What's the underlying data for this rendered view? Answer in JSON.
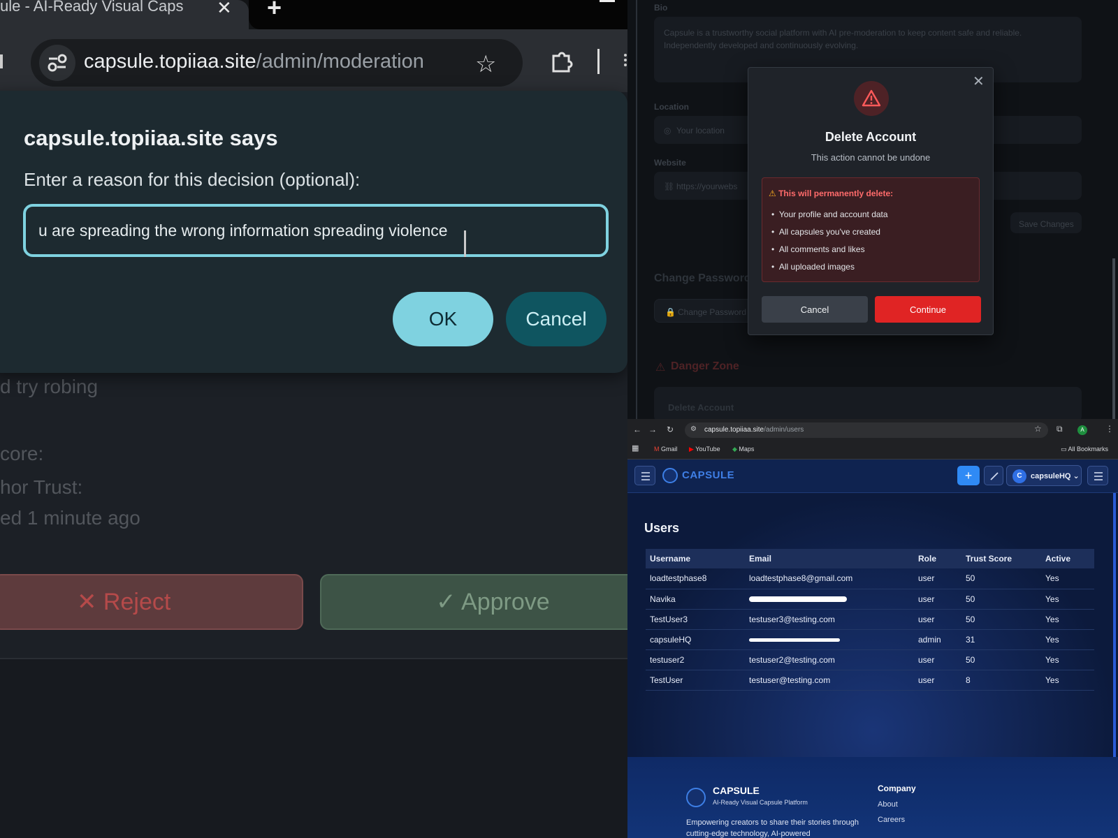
{
  "left": {
    "tab_title": "ule - AI-Ready Visual Caps",
    "tab_close": "✕",
    "new_tab": "+",
    "url_host": "capsule.topiiaa.site",
    "url_path": "/admin/moderation",
    "bg_text": {
      "line1": "d try robing",
      "line2": "core:",
      "line3": "hor Trust:",
      "line4": "ed 1 minute ago"
    },
    "reject_label": "✕  Reject",
    "approve_label": "✓  Approve",
    "dialog": {
      "title": "capsule.topiiaa.site says",
      "message": "Enter a reason for this decision (optional):",
      "input_value": "u are spreading the wrong information spreading violence",
      "ok_label": "OK",
      "cancel_label": "Cancel"
    }
  },
  "right_top": {
    "labels": {
      "bio": "Bio",
      "location": "Location",
      "website": "Website",
      "change_password": "Change Password",
      "change_password_button": "Change Password",
      "save_changes": "Save Changes",
      "danger_zone": "Danger Zone",
      "delete_account_button": "Delete Account"
    },
    "bio_text": "Capsule is a trustworthy social platform with AI pre-moderation to keep content safe and reliable. Independently developed and continuously evolving.",
    "location_placeholder": "Your location",
    "website_placeholder": "https://yourwebs",
    "modal": {
      "close": "✕",
      "title": "Delete Account",
      "subtitle": "This action cannot be undone",
      "warning_title": "This will permanently delete:",
      "items": [
        "Your profile and account data",
        "All capsules you've created",
        "All comments and likes",
        "All uploaded images"
      ],
      "cancel_label": "Cancel",
      "continue_label": "Continue"
    }
  },
  "right_bottom": {
    "url_host": "capsule.topiiaa.site",
    "url_path": "/admin/users",
    "bookmarks": [
      "Gmail",
      "YouTube",
      "Maps"
    ],
    "all_bookmarks": "All Bookmarks",
    "profile_initial": "A",
    "brand": "CAPSULE",
    "user_initial": "C",
    "user_name": "capsuleHQ",
    "page_title": "Users",
    "table": {
      "headers": [
        "Username",
        "Email",
        "Role",
        "Trust Score",
        "Active"
      ],
      "rows": [
        {
          "username": "loadtestphase8",
          "email": "loadtestphase8@gmail.com",
          "role": "user",
          "trust": "50",
          "active": "Yes"
        },
        {
          "username": "Navika",
          "email": "",
          "role": "user",
          "trust": "50",
          "active": "Yes"
        },
        {
          "username": "TestUser3",
          "email": "testuser3@testing.com",
          "role": "user",
          "trust": "50",
          "active": "Yes"
        },
        {
          "username": "capsuleHQ",
          "email": "",
          "role": "admin",
          "trust": "31",
          "active": "Yes"
        },
        {
          "username": "testuser2",
          "email": "testuser2@testing.com",
          "role": "user",
          "trust": "50",
          "active": "Yes"
        },
        {
          "username": "TestUser",
          "email": "testuser@testing.com",
          "role": "user",
          "trust": "8",
          "active": "Yes"
        }
      ]
    },
    "footer": {
      "brand": "CAPSULE",
      "tagline": "AI-Ready Visual Capsule Platform",
      "description": "Empowering creators to share their stories through cutting-edge technology, AI-powered",
      "company_heading": "Company",
      "links": [
        "About",
        "Careers"
      ]
    }
  }
}
